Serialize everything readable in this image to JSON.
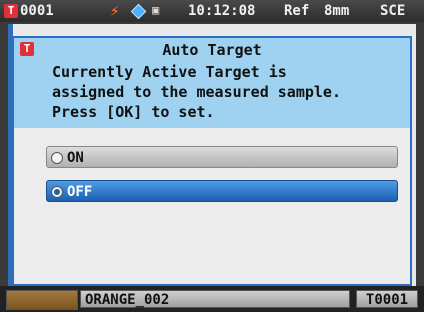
{
  "statusbar": {
    "target_icon": "T",
    "target_number": "0001",
    "icons": [
      "lightning-icon",
      "diamond-icon",
      "sd-card-icon"
    ],
    "time": "10:12:08",
    "reference": "Ref",
    "aperture": "8mm",
    "specular": "SCE"
  },
  "dialog": {
    "icon": "T",
    "title": "Auto Target",
    "message_lines": [
      "Currently Active Target is",
      "assigned to the measured sample.",
      "Press [OK] to set."
    ],
    "options": [
      {
        "label": "ON",
        "selected": false
      },
      {
        "label": "OFF",
        "selected": true
      }
    ]
  },
  "bottombar": {
    "sample_name": "ORANGE_002",
    "target_id": "T0001",
    "swatch_color": "#8e6630"
  },
  "colors": {
    "accent": "#2a6fc4",
    "dialog_header": "#9ed2f0",
    "selected_option": "#1f5fb0",
    "target_icon": "#e0303a"
  }
}
